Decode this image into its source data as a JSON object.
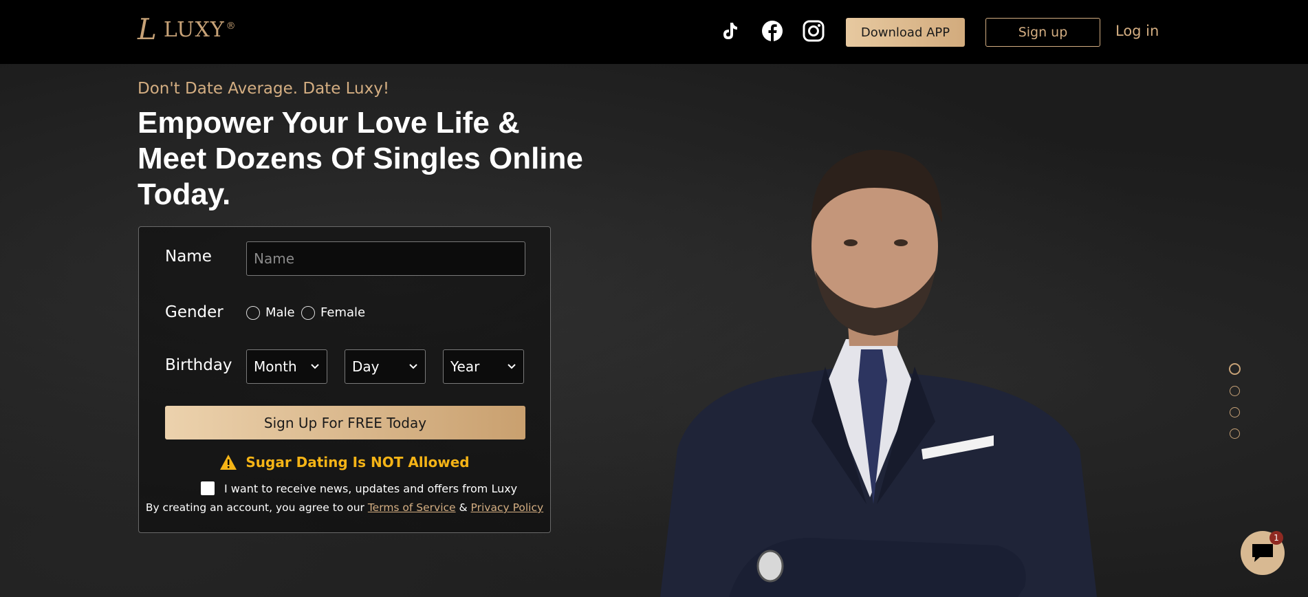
{
  "header": {
    "logo_mark": "L",
    "logo_text": "LUXY",
    "logo_reg": "®",
    "social_icons": [
      "tiktok-icon",
      "facebook-icon",
      "instagram-icon"
    ],
    "download_label": "Download APP",
    "signup_label": "Sign up",
    "login_label": "Log in"
  },
  "hero": {
    "tagline": "Don't Date Average. Date Luxy!",
    "headline": "Empower Your Love Life & Meet Dozens Of Singles Online Today."
  },
  "form": {
    "name_label": "Name",
    "name_placeholder": "Name",
    "name_value": "",
    "gender_label": "Gender",
    "gender_options": [
      "Male",
      "Female"
    ],
    "birthday_label": "Birthday",
    "month_value": "Month",
    "day_value": "Day",
    "year_value": "Year",
    "cta_label": "Sign Up For FREE Today",
    "warning_text": "Sugar Dating Is NOT Allowed",
    "optin_text": "I want to receive news, updates and offers from Luxy",
    "terms_prefix": "By creating an account, you agree to our ",
    "terms_link": "Terms of Service",
    "terms_amp": " & ",
    "privacy_link": "Privacy Policy"
  },
  "carousel": {
    "slide_count": 4,
    "active_index": 0
  },
  "chat": {
    "badge_count": "1"
  },
  "colors": {
    "gold": "#d4ae82",
    "warning": "#f5b416",
    "background": "#1c1c1c",
    "header": "#000000"
  }
}
